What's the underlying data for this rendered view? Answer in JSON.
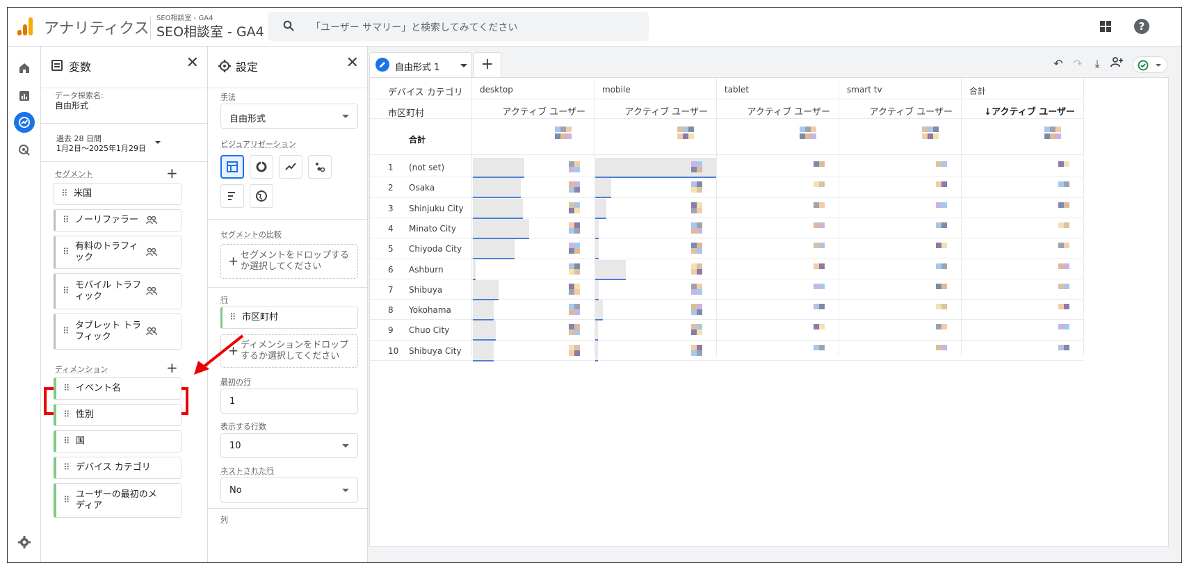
{
  "header": {
    "app_name": "アナリティクス",
    "property_small": "SEO相談室 - GA4",
    "property_name": "SEO相談室 - GA4",
    "search_placeholder": "「ユーザー サマリー」と検索してみてください"
  },
  "variables_panel": {
    "title": "変数",
    "exploration_name_label": "データ探索名:",
    "exploration_name": "自由形式",
    "date_range_label": "過去 28 日間",
    "date_range": "1月2日～2025年1月29日",
    "segments_label": "セグメント",
    "segments": [
      "米国",
      "ノーリファラー",
      "有料のトラフィック",
      "モバイル トラフィック",
      "タブレット トラフィック"
    ],
    "dimensions_label": "ディメンション",
    "dimensions": [
      "イベント名",
      "性別",
      "国",
      "デバイス カテゴリ",
      "ユーザーの最初のメディア"
    ]
  },
  "settings_panel": {
    "title": "設定",
    "technique_label": "手法",
    "technique_value": "自由形式",
    "visualization_label": "ビジュアリゼーション",
    "segment_compare_label": "セグメントの比較",
    "segment_drop_text": "セグメントをドロップするか選択してください",
    "rows_label": "行",
    "row_dimension": "市区町村",
    "dimension_drop_text": "ディメンションをドロップするか選択してください",
    "first_row_label": "最初の行",
    "first_row_value": "1",
    "show_rows_label": "表示する行数",
    "show_rows_value": "10",
    "nested_rows_label": "ネストされた行",
    "nested_rows_value": "No",
    "columns_label": "列"
  },
  "tab": {
    "label": "自由形式 1",
    "add": "+"
  },
  "table": {
    "col_dimension_label": "デバイス カテゴリ",
    "row_dimension_label": "市区町村",
    "columns": [
      "desktop",
      "mobile",
      "tablet",
      "smart tv",
      "合計"
    ],
    "metric_labels": [
      "アクティブ ユーザー",
      "アクティブ ユーザー",
      "アクティブ ユーザー",
      "アクティブ ユーザー",
      "↓アクティブ ユーザー"
    ],
    "total_label": "合計",
    "rows": [
      {
        "rank": "1",
        "city": "(not set)",
        "desktop": 0.42,
        "mobile": 0.99
      },
      {
        "rank": "2",
        "city": "Osaka",
        "desktop": 0.39,
        "mobile": 0.13
      },
      {
        "rank": "3",
        "city": "Shinjuku City",
        "desktop": 0.41,
        "mobile": 0.09
      },
      {
        "rank": "4",
        "city": "Minato City",
        "desktop": 0.46,
        "mobile": 0.03
      },
      {
        "rank": "5",
        "city": "Chiyoda City",
        "desktop": 0.34,
        "mobile": 0.03
      },
      {
        "rank": "6",
        "city": "Ashburn",
        "desktop": 0.02,
        "mobile": 0.25
      },
      {
        "rank": "7",
        "city": "Shibuya",
        "desktop": 0.21,
        "mobile": 0.03
      },
      {
        "rank": "8",
        "city": "Yokohama",
        "desktop": 0.17,
        "mobile": 0.06
      },
      {
        "rank": "9",
        "city": "Chuo City",
        "desktop": 0.19,
        "mobile": 0.02
      },
      {
        "rank": "10",
        "city": "Shibuya City",
        "desktop": 0.17,
        "mobile": 0.02
      }
    ]
  }
}
